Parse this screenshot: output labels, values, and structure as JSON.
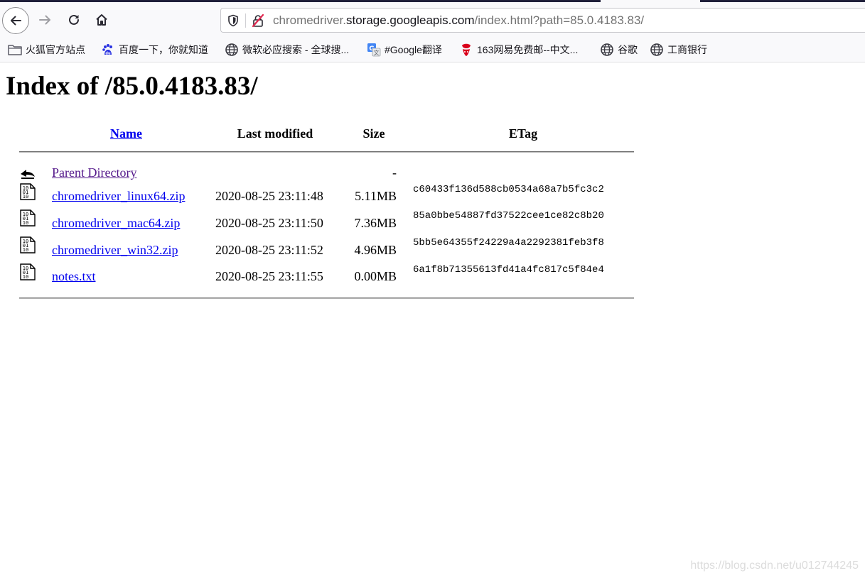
{
  "browser": {
    "url_prefix": "chromedriver.",
    "url_host": "storage.googleapis.com",
    "url_path": "/index.html?path=85.0.4183.83/",
    "bookmarks": [
      {
        "label": "火狐官方站点",
        "icon": "folder-icon"
      },
      {
        "label": "百度一下，你就知道",
        "icon": "baidu-paw-icon"
      },
      {
        "label": "微软必应搜索 - 全球搜...",
        "icon": "globe-icon"
      },
      {
        "label": "#Google翻译",
        "icon": "google-translate-icon"
      },
      {
        "label": "163网易免费邮--中文...",
        "icon": "netease-163-icon"
      },
      {
        "label": "谷歌",
        "icon": "globe-icon"
      },
      {
        "label": "工商银行",
        "icon": "globe-icon"
      }
    ]
  },
  "page": {
    "title": "Index of /85.0.4183.83/",
    "columns": {
      "name": "Name",
      "modified": "Last modified",
      "size": "Size",
      "etag": "ETag"
    },
    "parent": {
      "label": "Parent Directory",
      "size": "-"
    },
    "files": [
      {
        "name": "chromedriver_linux64.zip",
        "modified": "2020-08-25 23:11:48",
        "size": "5.11MB",
        "etag": "c60433f136d588cb0534a68a7b5fc3c2"
      },
      {
        "name": "chromedriver_mac64.zip",
        "modified": "2020-08-25 23:11:50",
        "size": "7.36MB",
        "etag": "85a0bbe54887fd37522cee1ce82c8b20"
      },
      {
        "name": "chromedriver_win32.zip",
        "modified": "2020-08-25 23:11:52",
        "size": "4.96MB",
        "etag": "5bb5e64355f24229a4a2292381feb3f8"
      },
      {
        "name": "notes.txt",
        "modified": "2020-08-25 23:11:55",
        "size": "0.00MB",
        "etag": "6a1f8b71355613fd41a4fc817c5f84e4"
      }
    ]
  },
  "watermark": "https://blog.csdn.net/u012744245"
}
